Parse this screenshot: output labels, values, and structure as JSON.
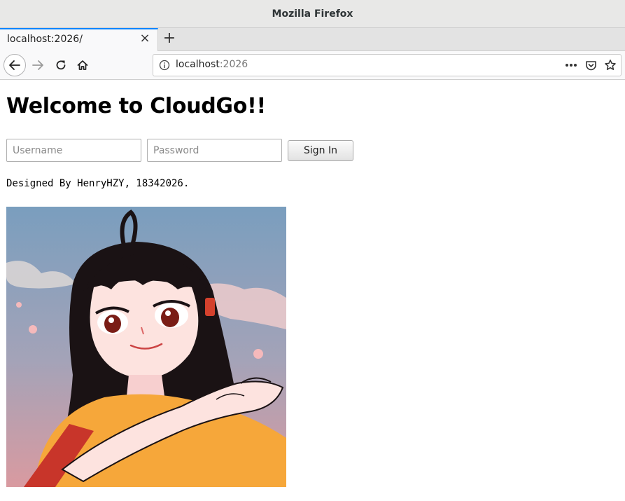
{
  "window": {
    "title": "Mozilla Firefox"
  },
  "tabs": [
    {
      "label": "localhost:2026/"
    }
  ],
  "tab_actions": {
    "close_symbol": "×",
    "new_tab_symbol": "+"
  },
  "navigation": {
    "url_host": "localhost",
    "url_port": ":2026",
    "icons": [
      "back-icon",
      "forward-icon",
      "reload-icon",
      "home-icon",
      "info-icon",
      "more-actions-icon",
      "pocket-icon",
      "bookmark-star-icon"
    ]
  },
  "page": {
    "heading": "Welcome to CloudGo!!",
    "username_placeholder": "Username",
    "password_placeholder": "Password",
    "signin_label": "Sign In",
    "credit": "Designed By HenryHZY, 18342026.",
    "image_subject": "anime-girl-illustration"
  },
  "colors": {
    "tab_accent": "#0a84ff",
    "sky_top": "#7a9ebe",
    "sky_bottom": "#d99aa0",
    "shirt": "#f6a73a"
  }
}
